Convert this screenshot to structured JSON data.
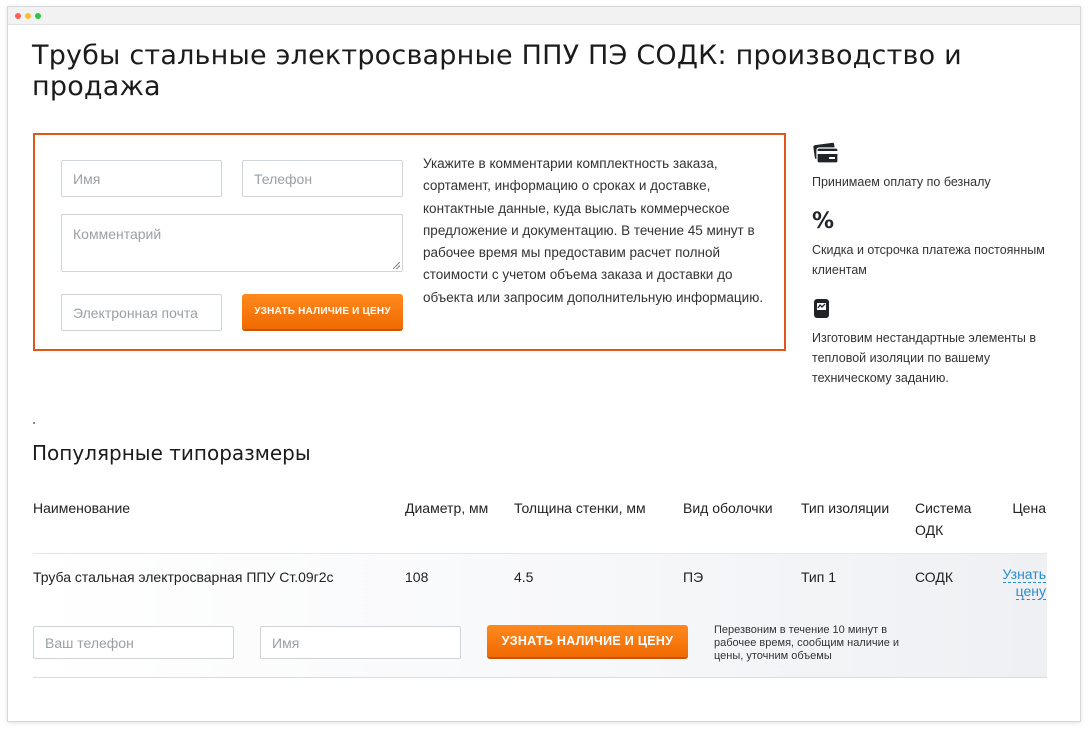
{
  "page": {
    "title": "Трубы стальные электросварные ППУ ПЭ СОДК: производство и продажа"
  },
  "order_form": {
    "name_placeholder": "Имя",
    "phone_placeholder": "Телефон",
    "comment_placeholder": "Комментарий",
    "email_placeholder": "Электронная почта",
    "submit_label": "Узнать наличие и цену",
    "info_text": "Укажите в комментарии комплектность заказа, сортамент, информацию о сроках и доставке, контактные данные, куда выслать коммерческое предложение и документацию. В течение 45 минут в рабочее время мы предоставим расчет полной стоимости с учетом объема заказа и доставки до объекта или запросим дополнительную информацию.",
    "border_color": "#e0561b"
  },
  "features": [
    {
      "icon": "credit-card-icon",
      "text": "Принимаем оплату по безналу"
    },
    {
      "icon": "percent-icon",
      "text": "Скидка и отсрочка платежа постоянным клиентам"
    },
    {
      "icon": "blueprint-icon",
      "text": "Изготовим нестандартные элементы в тепловой изоляции по вашему техническому заданию."
    }
  ],
  "popular": {
    "title": "Популярные типоразмеры",
    "columns": [
      "Наименование",
      "Диаметр, мм",
      "Толщина стенки, мм",
      "Вид оболочки",
      "Тип изоляции",
      "Система ОДК",
      "Цена"
    ],
    "rows": [
      {
        "name": "Труба стальная электросварная ППУ Ст.09г2с",
        "diameter": "108",
        "wall": "4.5",
        "sheath": "ПЭ",
        "insulation": "Тип 1",
        "odk": "СОДК",
        "price_link": "Узнать цену"
      }
    ],
    "callback": {
      "phone_placeholder": "Ваш телефон",
      "name_placeholder": "Имя",
      "button_label": "Узнать наличие и цену",
      "note": "Перезвоним в течение 10 минут в рабочее время, сообщим наличие и цены, уточним объемы"
    }
  },
  "colors": {
    "accent_orange": "#f06a00",
    "link_blue": "#2a8ccf"
  }
}
